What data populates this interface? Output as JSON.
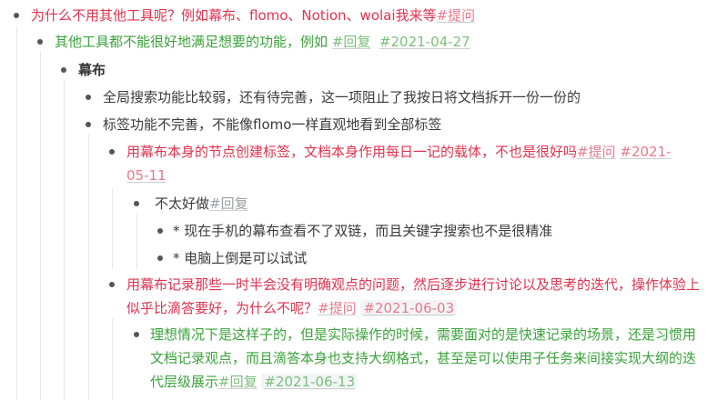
{
  "outline": {
    "n1": {
      "text": "为什么不用其他工具呢？例如幕布、flomo、Notion、wolai我来等",
      "tag": "#提问"
    },
    "n2": {
      "text": "其他工具都不能很好地满足想要的功能，例如",
      "tag": "#回复",
      "date": "#2021-04-27"
    },
    "n3": {
      "text": "幕布"
    },
    "n4": {
      "text": "全局搜索功能比较弱，还有待完善，这一项阻止了我按日将文档拆开一份一份的"
    },
    "n5": {
      "text": "标签功能不完善，不能像flomo一样直观地看到全部标签"
    },
    "n6": {
      "text": "用幕布本身的节点创建标签，文档本身作用每日一记的载体，不也是很好吗",
      "tag": "#提问",
      "date": "#2021-05-11"
    },
    "n7": {
      "text": "不太好做",
      "tag": "#回复"
    },
    "n8": {
      "text": "* 现在手机的幕布查看不了双链，而且关键字搜索也不是很精准"
    },
    "n9": {
      "text": "* 电脑上倒是可以试试"
    },
    "n10": {
      "text": "用幕布记录那些一时半会没有明确观点的问题，然后逐步进行讨论以及思考的迭代，操作体验上似乎比滴答要好，为什么不呢？",
      "tag": "#提问",
      "date": "#2021-06-03"
    },
    "n11": {
      "text": "理想情况下是这样子的，但是实际操作的时候，需要面对的是快速记录的场景，还是习惯用文档记录观点，而且滴答本身也支持大纲格式，甚至是可以使用子任务来间接实现大纲的迭代层级展示",
      "tag": "#回复",
      "date": "#2021-06-13"
    }
  },
  "colors": {
    "question": "#e0334f",
    "answer": "#3ba33b",
    "tag_question": "#e87b8c",
    "tag_answer": "#7cbf7c"
  }
}
